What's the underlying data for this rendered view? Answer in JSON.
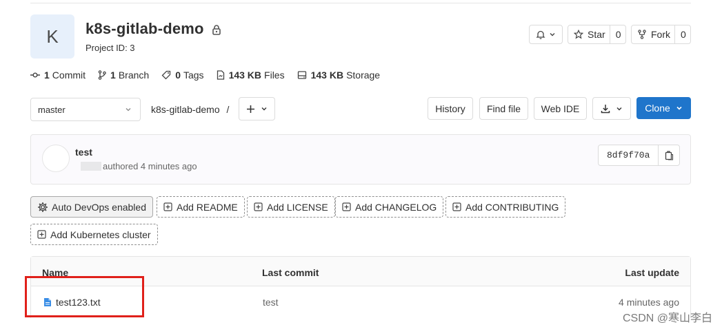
{
  "project": {
    "avatar_letter": "K",
    "name": "k8s-gitlab-demo",
    "id_label": "Project ID: 3"
  },
  "header_actions": {
    "star_label": "Star",
    "star_count": "0",
    "fork_label": "Fork",
    "fork_count": "0"
  },
  "stats": {
    "commits_value": "1",
    "commits_label": "Commit",
    "branches_value": "1",
    "branches_label": "Branch",
    "tags_value": "0",
    "tags_label": "Tags",
    "files_value": "143 KB",
    "files_label": "Files",
    "storage_value": "143 KB",
    "storage_label": "Storage"
  },
  "toolbar": {
    "branch": "master",
    "breadcrumb_repo": "k8s-gitlab-demo",
    "breadcrumb_sep": "/",
    "history_label": "History",
    "find_file_label": "Find file",
    "web_ide_label": "Web IDE",
    "clone_label": "Clone"
  },
  "last_commit": {
    "title": "test",
    "meta": "authored 4 minutes ago",
    "sha": "8df9f70a"
  },
  "quick_actions": {
    "auto_devops": "Auto DevOps enabled",
    "add_readme": "Add README",
    "add_license": "Add LICENSE",
    "add_changelog": "Add CHANGELOG",
    "add_contributing": "Add CONTRIBUTING",
    "add_kubernetes": "Add Kubernetes cluster"
  },
  "file_table": {
    "headers": {
      "name": "Name",
      "last_commit": "Last commit",
      "last_update": "Last update"
    },
    "rows": [
      {
        "name": "test123.txt",
        "last_commit": "test",
        "last_update": "4 minutes ago"
      }
    ]
  },
  "watermark": "CSDN @寒山李白",
  "colors": {
    "primary_button": "#1f75cb",
    "highlight_box": "#e0201a"
  }
}
